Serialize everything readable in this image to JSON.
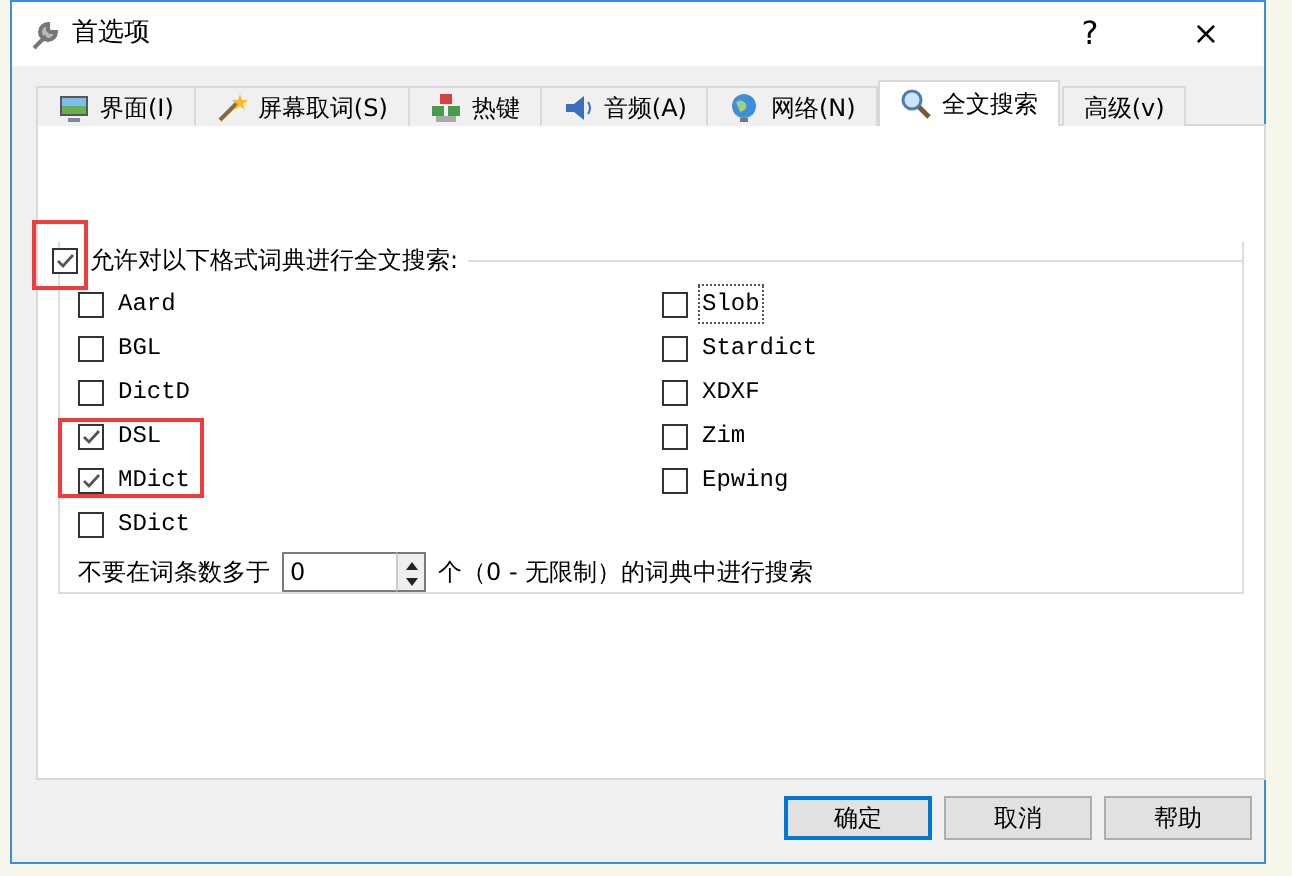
{
  "window": {
    "title": "首选项",
    "help_button": "?",
    "close_button": "×"
  },
  "tabs": [
    {
      "label": "界面(I)",
      "selected": false
    },
    {
      "label": "屏幕取词(S)",
      "selected": false
    },
    {
      "label": "热键",
      "selected": false
    },
    {
      "label": "音频(A)",
      "selected": false
    },
    {
      "label": "网络(N)",
      "selected": false
    },
    {
      "label": "全文搜索",
      "selected": true
    },
    {
      "label": "高级(v)",
      "selected": false
    }
  ],
  "full_text_search": {
    "enable": {
      "label": "允许对以下格式词典进行全文搜索:",
      "checked": true,
      "highlighted": true
    },
    "formats": {
      "column_1": [
        {
          "label": "Aard",
          "checked": false,
          "focused": false
        },
        {
          "label": "BGL",
          "checked": false,
          "focused": false
        },
        {
          "label": "DictD",
          "checked": false,
          "focused": false
        },
        {
          "label": "DSL",
          "checked": true,
          "focused": false,
          "highlighted": true
        },
        {
          "label": "MDict",
          "checked": true,
          "focused": false,
          "highlighted": true
        },
        {
          "label": "SDict",
          "checked": false,
          "focused": false
        }
      ],
      "column_2": [
        {
          "label": "Slob",
          "checked": false,
          "focused": true
        },
        {
          "label": "Stardict",
          "checked": false,
          "focused": false
        },
        {
          "label": "XDXF",
          "checked": false,
          "focused": false
        },
        {
          "label": "Zim",
          "checked": false,
          "focused": false
        },
        {
          "label": "Epwing",
          "checked": false,
          "focused": false
        }
      ]
    },
    "limit": {
      "prefix": "不要在词条数多于",
      "value": "0",
      "suffix": "个（0 - 无限制）的词典中进行搜索"
    }
  },
  "buttons": [
    {
      "label": "确定",
      "default": true
    },
    {
      "label": "取消",
      "default": false
    },
    {
      "label": "帮助",
      "default": false
    }
  ]
}
